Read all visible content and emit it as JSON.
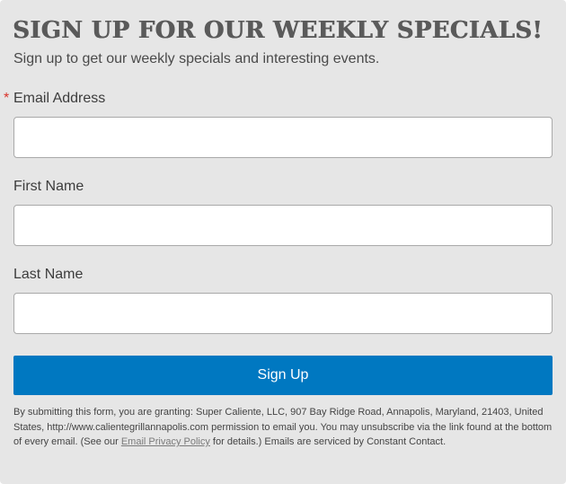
{
  "form": {
    "headline": "SIGN UP FOR OUR WEEKLY SPECIALS!",
    "subheadline": "Sign up to get our weekly specials and interesting events.",
    "required_marker": "*",
    "fields": {
      "email": {
        "label": "Email Address",
        "value": "",
        "placeholder": ""
      },
      "first_name": {
        "label": "First Name",
        "value": "",
        "placeholder": ""
      },
      "last_name": {
        "label": "Last Name",
        "value": "",
        "placeholder": ""
      }
    },
    "submit_label": "Sign Up",
    "disclaimer": {
      "text_before_link": "By submitting this form, you are granting: Super Caliente, LLC, 907 Bay Ridge Road, Annapolis, Maryland, 21403, United States, http://www.calientegrillannapolis.com permission to email you. You may unsubscribe via the link found at the bottom of every email. (See our ",
      "link_text": "Email Privacy Policy",
      "text_after_link": " for details.) Emails are serviced by Constant Contact."
    }
  },
  "colors": {
    "background": "#e6e6e6",
    "headline": "#5a5a5a",
    "button": "#0078c1",
    "required": "#d9342b"
  }
}
